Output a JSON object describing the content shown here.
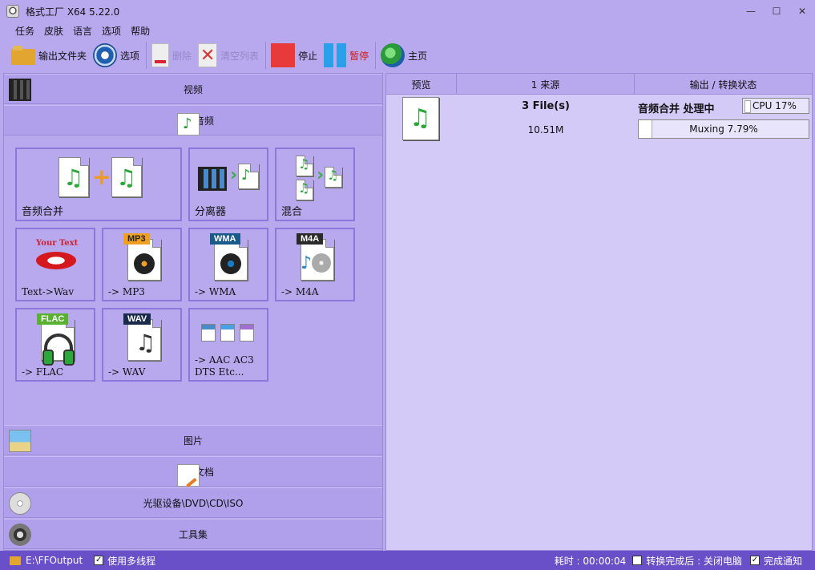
{
  "window": {
    "title": "格式工厂 X64 5.22.0",
    "controls": {
      "minimize": "—",
      "maximize": "☐",
      "close": "✕"
    }
  },
  "menu": [
    "任务",
    "皮肤",
    "语言",
    "选项",
    "帮助"
  ],
  "toolbar": {
    "output_folder": "输出文件夹",
    "options": "选项",
    "delete": "删除",
    "clear_list": "清空列表",
    "stop": "停止",
    "pause": "暂停",
    "home": "主页"
  },
  "categories": {
    "video": "视频",
    "audio": "音频",
    "picture": "图片",
    "document": "文档",
    "disc": "光驱设备\\DVD\\CD\\ISO",
    "tools": "工具集"
  },
  "audio_tiles": {
    "merge": "音频合并",
    "splitter": "分离器",
    "mix": "混合",
    "text_wav": "Text->Wav",
    "text_wav_icon_text": "Your Text",
    "mp3": "-> MP3",
    "wma": "-> WMA",
    "m4a": "-> M4A",
    "flac": "-> FLAC",
    "wav": "-> WAV",
    "aac_line1": "-> AAC AC3",
    "aac_line2": "DTS Etc...",
    "badges": {
      "mp3": "MP3",
      "wma": "WMA",
      "m4a": "M4A",
      "flac": "FLAC",
      "wav": "WAV"
    },
    "badge_colors": {
      "mp3": "#f0a020",
      "wma": "#1a5a8a",
      "m4a": "#2a2a2a",
      "flac": "#5ab030",
      "wav": "#1a2a4a"
    }
  },
  "task_list": {
    "columns": [
      "预览",
      "1 来源",
      "输出 / 转换状态"
    ],
    "rows": [
      {
        "files": "3 File(s)",
        "size": "10.51M",
        "status": "音频合并 处理中",
        "cpu": "CPU 17%",
        "progress_text": "Muxing 7.79%",
        "progress_pct": 7.79
      }
    ]
  },
  "statusbar": {
    "output_path": "E:\\FFOutput",
    "multithread_label": "使用多线程",
    "elapsed": "耗时 : 00:00:04",
    "after_convert": "转换完成后 : 关闭电脑",
    "notify": "完成通知"
  },
  "colors": {
    "accent": "#b8a8ee",
    "statusbar": "#6a50c8",
    "stop": "#e83a3a",
    "pause": "#2aa0e8"
  }
}
